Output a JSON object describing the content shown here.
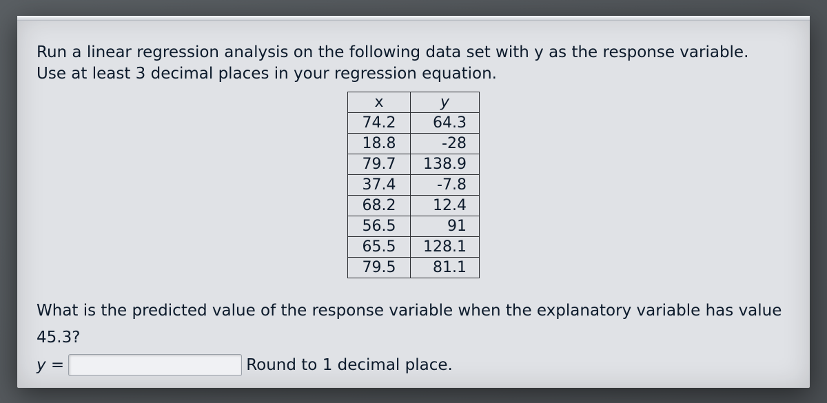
{
  "prompt": {
    "line1": "Run a linear regression analysis on the following data set with y as the response variable.",
    "line2": "Use at least 3 decimal places in your regression equation."
  },
  "table": {
    "headers": [
      "x",
      "y"
    ],
    "rows": [
      {
        "x": "74.2",
        "y": "64.3"
      },
      {
        "x": "18.8",
        "y": "-28"
      },
      {
        "x": "79.7",
        "y": "138.9"
      },
      {
        "x": "37.4",
        "y": "-7.8"
      },
      {
        "x": "68.2",
        "y": "12.4"
      },
      {
        "x": "56.5",
        "y": "91"
      },
      {
        "x": "65.5",
        "y": "128.1"
      },
      {
        "x": "79.5",
        "y": "81.1"
      }
    ]
  },
  "question": {
    "text": "What is the predicted value of the response variable when the explanatory variable has value 45.3?"
  },
  "answer": {
    "label": "y =",
    "placeholder": "",
    "round_hint": "Round to 1 decimal place."
  },
  "chart_data": {
    "type": "table",
    "title": "Linear regression data set",
    "columns": [
      "x",
      "y"
    ],
    "x": [
      74.2,
      18.8,
      79.7,
      37.4,
      68.2,
      56.5,
      65.5,
      79.5
    ],
    "y": [
      64.3,
      -28,
      138.9,
      -7.8,
      12.4,
      91,
      128.1,
      81.1
    ]
  }
}
